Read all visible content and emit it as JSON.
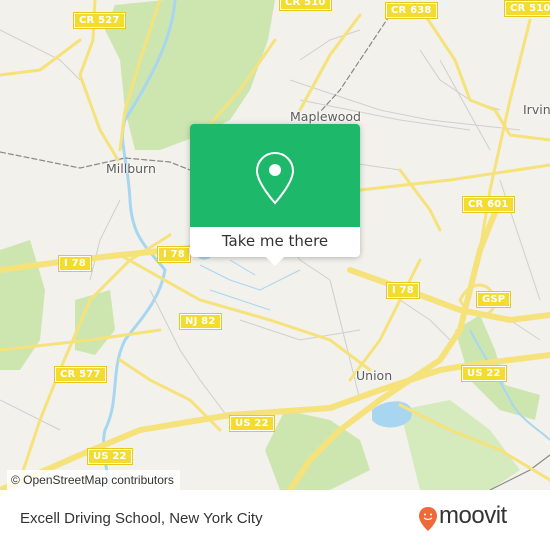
{
  "map": {
    "place_labels": [
      "Maplewood",
      "Millburn",
      "Irvin",
      "Union"
    ],
    "road_shields": [
      "CR 527",
      "CR 510",
      "CR 638",
      "CR 510",
      "CR 601",
      "I 78",
      "I 78",
      "I 78",
      "NJ 82",
      "GSP",
      "CR 577",
      "US 22",
      "US 22",
      "US 22"
    ],
    "attribution": "© OpenStreetMap contributors",
    "colors": {
      "land": "#f2f1ec",
      "park": "#cde6b0",
      "water": "#a8d6f0",
      "major_road": "#f6e27a",
      "minor_road": "#cfcfcf",
      "shield": "#f3dc2e"
    }
  },
  "popup": {
    "icon": "map-pin-icon",
    "button_label": "Take me there",
    "color": "#1eb86a"
  },
  "footer": {
    "place_name": "Excell Driving School, New York City",
    "brand": "moovit",
    "brand_color": "#ef6a3a"
  }
}
